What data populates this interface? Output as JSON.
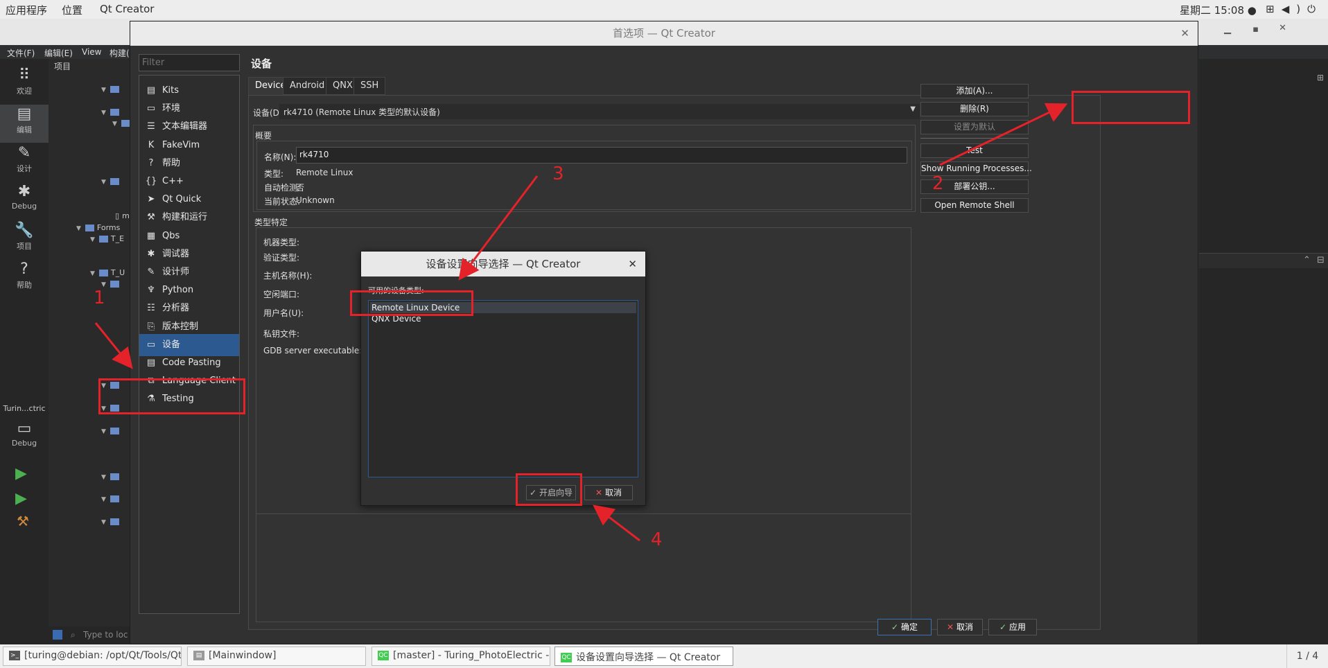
{
  "top_panel": {
    "menus": [
      "应用程序",
      "位置",
      "Qt Creator"
    ],
    "clock": "星期二 15:08 ●",
    "sys_icons": [
      "network-icon",
      "volume-icon",
      "power-icon"
    ]
  },
  "back_window": {
    "menubar": [
      "文件(F)",
      "编辑(E)",
      "View",
      "构建("
    ],
    "project_label": "项目",
    "modes": [
      {
        "label": "欢迎",
        "icon": "grid-icon"
      },
      {
        "label": "编辑",
        "icon": "edit-icon"
      },
      {
        "label": "设计",
        "icon": "pen-icon"
      },
      {
        "label": "Debug",
        "icon": "bug-icon"
      },
      {
        "label": "项目",
        "icon": "wrench-icon"
      },
      {
        "label": "帮助",
        "icon": "help-icon"
      }
    ],
    "kit_name": "Turin...ctric",
    "kit_mode": "Debug",
    "tree": [
      {
        "text": "ma",
        "kind": "file"
      },
      {
        "text": "Forms",
        "kind": "folder"
      },
      {
        "text": "T_E",
        "kind": "folder"
      },
      {
        "text": "T_U",
        "kind": "folder"
      }
    ],
    "locator_placeholder": "Type to loc"
  },
  "prefs": {
    "title": "首选项 — Qt Creator",
    "filter_placeholder": "Filter",
    "heading": "设备",
    "categories": [
      {
        "label": "Kits",
        "icon": "kits-icon",
        "glyph": "▤"
      },
      {
        "label": "环境",
        "icon": "monitor-icon",
        "glyph": "▭"
      },
      {
        "label": "文本编辑器",
        "icon": "text-editor-icon",
        "glyph": "☰"
      },
      {
        "label": "FakeVim",
        "icon": "fakevim-icon",
        "glyph": "K"
      },
      {
        "label": "帮助",
        "icon": "help-icon",
        "glyph": "?"
      },
      {
        "label": "C++",
        "icon": "cpp-icon",
        "glyph": "{}"
      },
      {
        "label": "Qt Quick",
        "icon": "qtquick-icon",
        "glyph": "➤"
      },
      {
        "label": "构建和运行",
        "icon": "hammer-icon",
        "glyph": "⚒"
      },
      {
        "label": "Qbs",
        "icon": "qbs-icon",
        "glyph": "▦"
      },
      {
        "label": "调试器",
        "icon": "bug-icon",
        "glyph": "✱"
      },
      {
        "label": "设计师",
        "icon": "pen-icon",
        "glyph": "✎"
      },
      {
        "label": "Python",
        "icon": "python-icon",
        "glyph": "♆"
      },
      {
        "label": "分析器",
        "icon": "analyzer-icon",
        "glyph": "☷"
      },
      {
        "label": "版本控制",
        "icon": "vcs-icon",
        "glyph": "⎘"
      },
      {
        "label": "设备",
        "icon": "device-icon",
        "glyph": "▭"
      },
      {
        "label": "Code Pasting",
        "icon": "paste-icon",
        "glyph": "▤"
      },
      {
        "label": "Language Client",
        "icon": "language-client-icon",
        "glyph": "⧉"
      },
      {
        "label": "Testing",
        "icon": "testing-icon",
        "glyph": "⚗"
      }
    ],
    "selected_category": "设备",
    "tabs": [
      "Devices",
      "Android",
      "QNX",
      "SSH"
    ],
    "device_label": "设备(D):",
    "device_value": "rk4710 (Remote Linux 类型的默认设备)",
    "overview_title": "概要",
    "name_label": "名称(N):",
    "name_value": "rk4710",
    "type_label": "类型:",
    "type_value": "Remote Linux",
    "autodetect_label": "自动检测:",
    "autodetect_value": "否",
    "state_label": "当前状态:",
    "state_value": "Unknown",
    "specific_title": "类型特定",
    "specific_labels": [
      "机器类型:",
      "验证类型:",
      "主机名称(H):",
      "空闲端口:",
      "用户名(U):",
      "私钥文件:",
      "GDB server executable:"
    ],
    "side_buttons": [
      {
        "label": "添加(A)...",
        "enabled": true
      },
      {
        "label": "删除(R)",
        "enabled": true
      },
      {
        "label": "设置为默认",
        "enabled": false
      },
      {
        "label": "Test",
        "enabled": true
      },
      {
        "label": "Show Running Processes...",
        "enabled": true
      },
      {
        "label": "部署公钥...",
        "enabled": true
      },
      {
        "label": "Open Remote Shell",
        "enabled": true
      }
    ],
    "ok_label": "确定",
    "cancel_label": "取消",
    "apply_label": "应用"
  },
  "wizard": {
    "title": "设备设置向导选择 — Qt Creator",
    "list_label": "可用的设备类型:",
    "items": [
      "Remote Linux Device",
      "QNX Device"
    ],
    "selected_item": "Remote Linux Device",
    "start_label": "开启向导",
    "cancel_label": "取消"
  },
  "annotations": {
    "numbers": [
      "1",
      "2",
      "3",
      "4"
    ],
    "color": "#e4222a"
  },
  "taskbar": {
    "tasks": [
      {
        "label": "[turing@debian: /opt/Qt/Tools/Qt...",
        "icon": "terminal-icon"
      },
      {
        "label": "[Mainwindow]",
        "icon": "window-icon"
      },
      {
        "label": "[master] - Turing_PhotoElectric - ...",
        "icon": "qt-icon"
      },
      {
        "label": "设备设置向导选择 — Qt Creator",
        "icon": "qt-icon"
      }
    ],
    "pager": "1 / 4"
  },
  "colors": {
    "selection": "#2c5a90",
    "annotation": "#e4222a",
    "background": "#313131"
  }
}
